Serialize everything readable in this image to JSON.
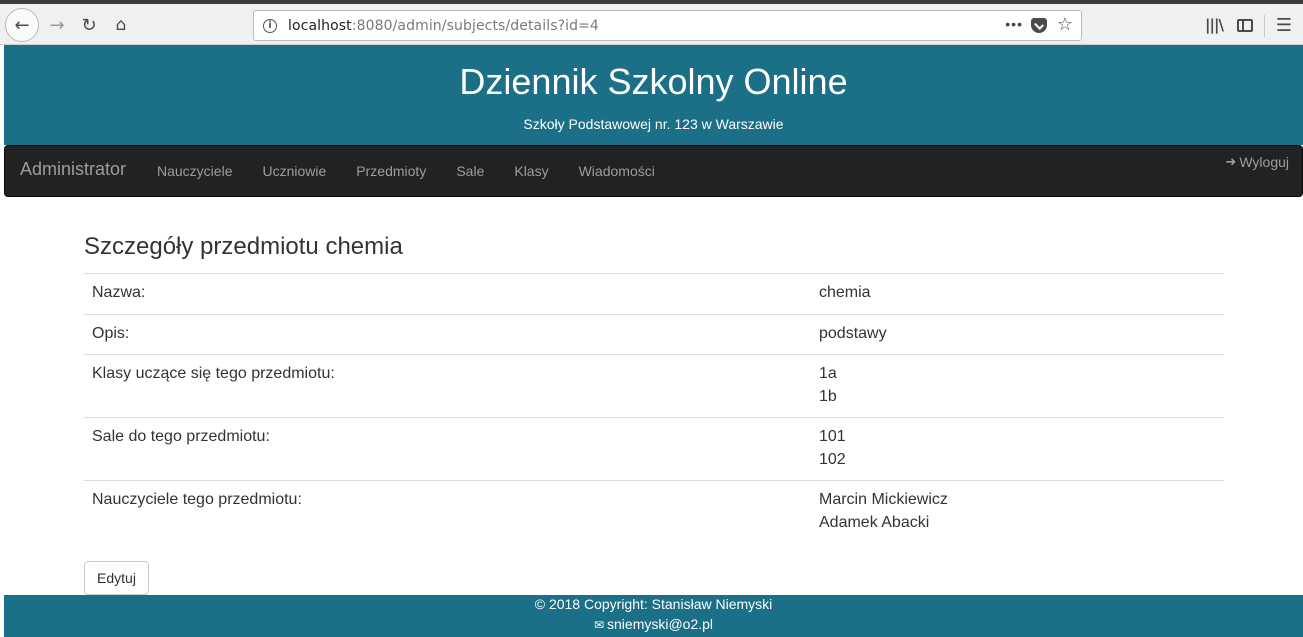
{
  "browser": {
    "url_host": "localhost",
    "url_rest": ":8080/admin/subjects/details?id=4",
    "icons": [
      "back-icon",
      "forward-icon",
      "reload-icon",
      "home-icon",
      "info-icon",
      "page-actions-icon",
      "pocket-icon",
      "bookmark-star-icon",
      "library-icon",
      "sidebar-icon",
      "menu-icon"
    ]
  },
  "header": {
    "title": "Dziennik Szkolny Online",
    "subtitle": "Szkoły Podstawowej nr. 123 w Warszawie",
    "bg_color": "#1b6f86"
  },
  "navbar": {
    "brand": "Administrator",
    "links": [
      "Nauczyciele",
      "Uczniowie",
      "Przedmioty",
      "Sale",
      "Klasy",
      "Wiadomości"
    ],
    "logout": "Wyloguj",
    "bg_color": "#222222"
  },
  "main": {
    "heading": "Szczegóły przedmiotu chemia",
    "rows": [
      {
        "label": "Nazwa:",
        "values": [
          "chemia"
        ]
      },
      {
        "label": "Opis:",
        "values": [
          "podstawy"
        ]
      },
      {
        "label": "Klasy uczące się tego przedmiotu:",
        "values": [
          "1a",
          "1b"
        ]
      },
      {
        "label": "Sale do tego przedmiotu:",
        "values": [
          "101",
          "102"
        ]
      },
      {
        "label": "Nauczyciele tego przedmiotu:",
        "values": [
          "Marcin Mickiewicz",
          "Adamek Abacki"
        ]
      }
    ],
    "edit_label": "Edytuj"
  },
  "footer": {
    "copyright": "© 2018 Copyright: Stanisław Niemyski",
    "email": "sniemyski@o2.pl"
  }
}
